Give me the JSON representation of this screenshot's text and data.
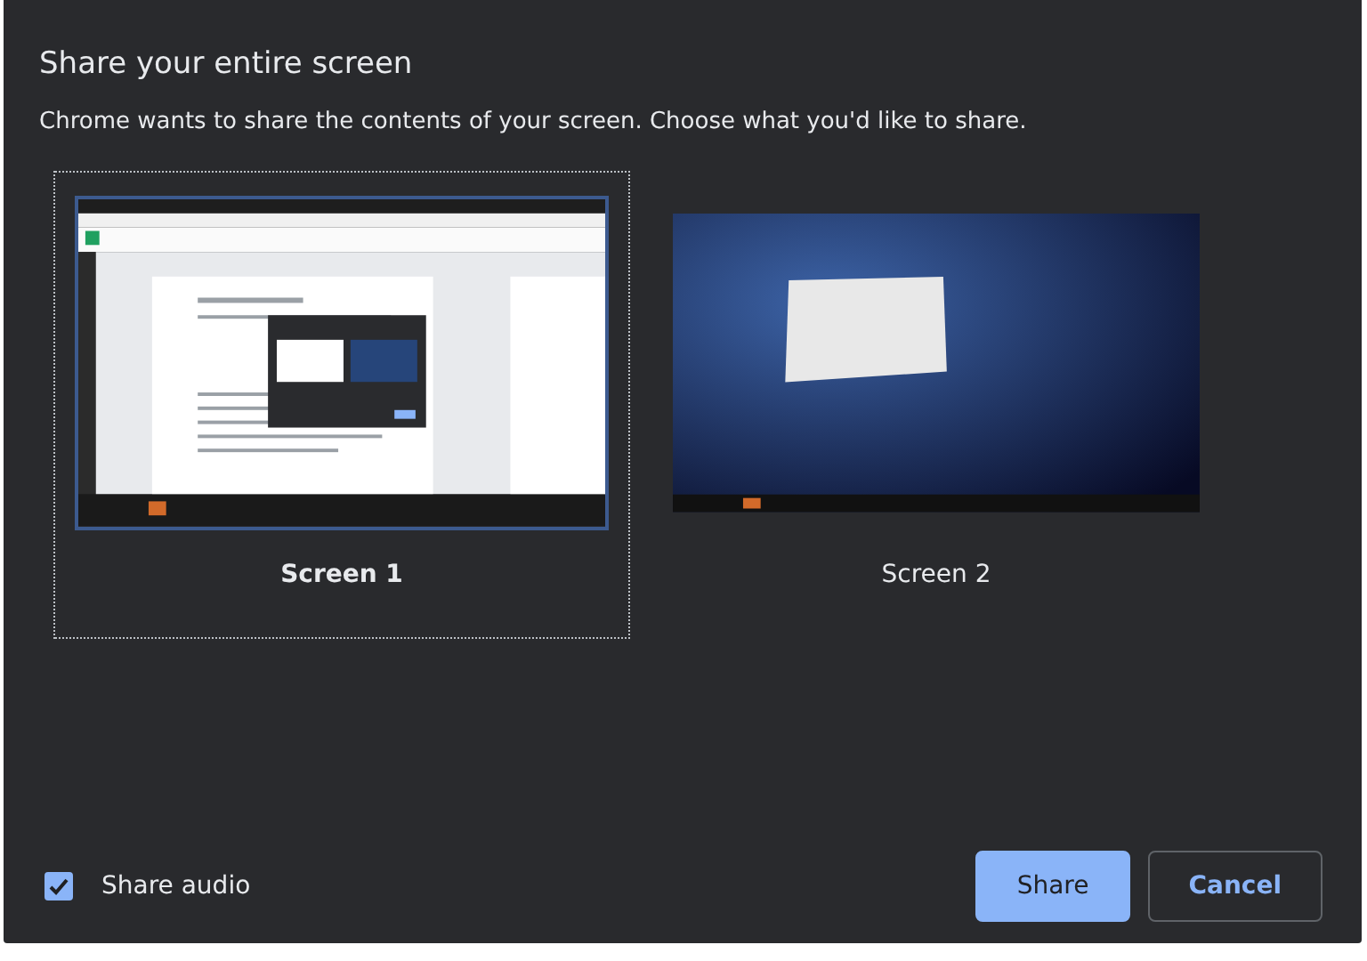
{
  "dialog": {
    "title": "Share your entire screen",
    "description": "Chrome wants to share the contents of your screen. Choose what you'd like to share."
  },
  "screens": [
    {
      "label": "Screen 1",
      "selected": true,
      "kind": "desktop"
    },
    {
      "label": "Screen 2",
      "selected": false,
      "kind": "wallpaper"
    }
  ],
  "share_audio": {
    "label": "Share audio",
    "checked": true
  },
  "buttons": [
    {
      "label": "Share",
      "kind": "primary"
    },
    {
      "label": "Cancel",
      "kind": "secondary"
    }
  ]
}
